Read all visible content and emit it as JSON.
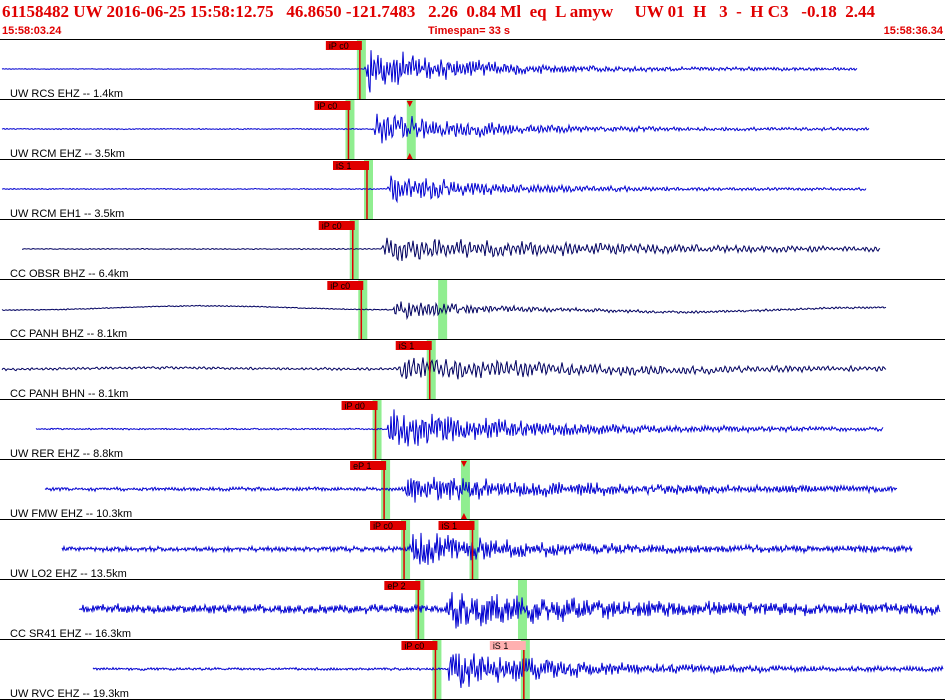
{
  "header": {
    "title_line": "61158482 UW 2016-06-25 15:58:12.75   46.8650 -121.7483   2.26  0.84 Ml  eq  L amyw     UW 01  H   3  -  H C3   -0.18  2.44",
    "time_start": "15:58:03.24",
    "timespan": "Timespan=  33 s",
    "time_end": "15:58:36.34"
  },
  "colors": {
    "title": "#e00000",
    "trace_uw": "#0000d0",
    "trace_cc": "#000060",
    "pick_flag": "#e00000",
    "pick_flag_secondary": "#ffb0b0",
    "pick_window": "#90ee90",
    "separator": "#000000"
  },
  "timespan_seconds": 33,
  "channels": [
    {
      "label": "UW RCS EHZ -- 1.4km",
      "network": "UW",
      "color": "#0000d0",
      "picks": [
        {
          "label": "iP c0",
          "t": 12.55,
          "window": true,
          "style": "primary"
        }
      ],
      "trace": {
        "start": 0.0,
        "end": 30.0,
        "onset": 12.7,
        "noise": 0.012,
        "peak": 0.95,
        "decay": 3.0,
        "freq": 2.2,
        "drift": 0.0
      }
    },
    {
      "label": "UW RCM EHZ -- 3.5km",
      "network": "UW",
      "color": "#0000d0",
      "picks": [
        {
          "label": "iP c0",
          "t": 12.15,
          "window": true,
          "style": "primary"
        },
        {
          "label": "",
          "t": 14.3,
          "window": true,
          "style": "triangle"
        }
      ],
      "trace": {
        "start": 0.0,
        "end": 30.4,
        "onset": 13.0,
        "noise": 0.02,
        "peak": 0.55,
        "decay": 4.0,
        "freq": 2.0,
        "drift": 0.0
      }
    },
    {
      "label": "UW RCM EH1 -- 3.5km",
      "network": "UW",
      "color": "#0000d0",
      "picks": [
        {
          "label": "iS 1",
          "t": 12.8,
          "window": true,
          "style": "primary"
        }
      ],
      "trace": {
        "start": 0.0,
        "end": 30.3,
        "onset": 13.5,
        "noise": 0.02,
        "peak": 0.55,
        "decay": 3.5,
        "freq": 2.0,
        "drift": 0.0
      }
    },
    {
      "label": "CC OBSR BHZ -- 6.4km",
      "network": "CC",
      "color": "#000060",
      "picks": [
        {
          "label": "iP c0",
          "t": 12.3,
          "window": true,
          "style": "primary"
        }
      ],
      "trace": {
        "start": 0.7,
        "end": 30.8,
        "onset": 13.3,
        "noise": 0.02,
        "peak": 0.45,
        "decay": 8.0,
        "freq": 1.6,
        "drift": 0.0
      }
    },
    {
      "label": "CC PANH BHZ -- 8.1km",
      "network": "CC",
      "color": "#000060",
      "picks": [
        {
          "label": "iP c0",
          "t": 12.6,
          "window": true,
          "style": "primary"
        },
        {
          "label": "",
          "t": 15.4,
          "window": true,
          "style": "none"
        }
      ],
      "trace": {
        "start": 0.0,
        "end": 31.0,
        "onset": 13.7,
        "noise": 0.02,
        "peak": 0.35,
        "decay": 3.0,
        "freq": 1.8,
        "drift": 0.2
      }
    },
    {
      "label": "CC PANH BHN -- 8.1km",
      "network": "CC",
      "color": "#000060",
      "picks": [
        {
          "label": "iS 1",
          "t": 15.0,
          "window": true,
          "style": "primary"
        }
      ],
      "trace": {
        "start": 0.0,
        "end": 31.0,
        "onset": 13.9,
        "noise": 0.05,
        "peak": 0.45,
        "decay": 6.0,
        "freq": 1.5,
        "drift": 0.08
      }
    },
    {
      "label": "UW RER EHZ -- 8.8km",
      "network": "UW",
      "color": "#0000d0",
      "picks": [
        {
          "label": "iP d0",
          "t": 13.1,
          "window": true,
          "style": "primary"
        }
      ],
      "trace": {
        "start": 1.2,
        "end": 30.9,
        "onset": 13.5,
        "noise": 0.03,
        "peak": 0.75,
        "decay": 4.5,
        "freq": 2.2,
        "drift": 0.0
      }
    },
    {
      "label": "UW FMW EHZ -- 10.3km",
      "network": "UW",
      "color": "#0000d0",
      "picks": [
        {
          "label": "eP 1",
          "t": 13.4,
          "window": true,
          "style": "primary"
        },
        {
          "label": "",
          "t": 16.2,
          "window": true,
          "style": "triangle"
        }
      ],
      "trace": {
        "start": 1.5,
        "end": 31.4,
        "onset": 14.0,
        "noise": 0.07,
        "peak": 0.5,
        "decay": 6.0,
        "freq": 2.4,
        "drift": 0.0
      }
    },
    {
      "label": "UW LO2 EHZ -- 13.5km",
      "network": "UW",
      "color": "#0000d0",
      "picks": [
        {
          "label": "iP c0",
          "t": 14.1,
          "window": true,
          "style": "primary"
        },
        {
          "label": "iS 1",
          "t": 16.5,
          "window": true,
          "style": "primary"
        }
      ],
      "trace": {
        "start": 2.1,
        "end": 31.9,
        "onset": 14.3,
        "noise": 0.1,
        "peak": 0.7,
        "decay": 3.0,
        "freq": 2.6,
        "drift": 0.0
      }
    },
    {
      "label": "CC SR41 EHZ -- 16.3km",
      "network": "CC",
      "color": "#0000d0",
      "picks": [
        {
          "label": "eP 2",
          "t": 14.6,
          "window": true,
          "style": "primary"
        },
        {
          "label": "",
          "t": 18.2,
          "window": true,
          "style": "none"
        }
      ],
      "trace": {
        "start": 2.7,
        "end": 32.9,
        "onset": 15.5,
        "noise": 0.18,
        "peak": 0.55,
        "decay": 5.0,
        "freq": 2.8,
        "drift": 0.0
      }
    },
    {
      "label": "UW RVC EHZ -- 19.3km",
      "network": "UW",
      "color": "#0000d0",
      "picks": [
        {
          "label": "iP c0",
          "t": 15.2,
          "window": true,
          "style": "primary"
        },
        {
          "label": "iS 1",
          "t": 18.3,
          "window": true,
          "style": "secondary"
        }
      ],
      "trace": {
        "start": 3.2,
        "end": 33.0,
        "onset": 15.6,
        "noise": 0.05,
        "peak": 0.75,
        "decay": 4.0,
        "freq": 2.4,
        "drift": 0.0
      }
    }
  ]
}
